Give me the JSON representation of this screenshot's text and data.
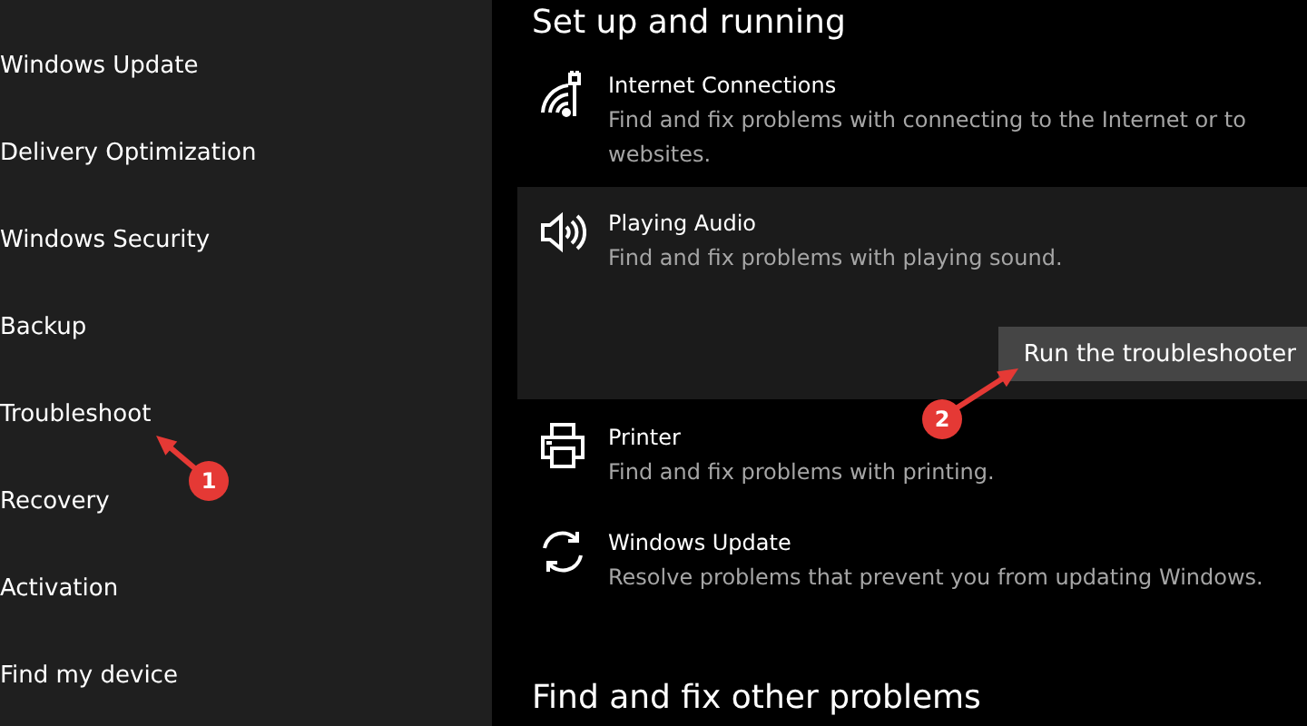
{
  "sidebar": {
    "items": [
      {
        "label": "Windows Update"
      },
      {
        "label": "Delivery Optimization"
      },
      {
        "label": "Windows Security"
      },
      {
        "label": "Backup"
      },
      {
        "label": "Troubleshoot"
      },
      {
        "label": "Recovery"
      },
      {
        "label": "Activation"
      },
      {
        "label": "Find my device"
      }
    ]
  },
  "main": {
    "heading": "Set up and running",
    "troubleshooters": [
      {
        "title": "Internet Connections",
        "description": "Find and fix problems with connecting to the Internet or to websites.",
        "expanded": false
      },
      {
        "title": "Playing Audio",
        "description": "Find and fix problems with playing sound.",
        "expanded": true,
        "button": "Run the troubleshooter"
      },
      {
        "title": "Printer",
        "description": "Find and fix problems with printing.",
        "expanded": false
      },
      {
        "title": "Windows Update",
        "description": "Resolve problems that prevent you from updating Windows.",
        "expanded": false
      }
    ],
    "section_heading": "Find and fix other problems"
  },
  "annotations": [
    {
      "label": "1"
    },
    {
      "label": "2"
    }
  ]
}
